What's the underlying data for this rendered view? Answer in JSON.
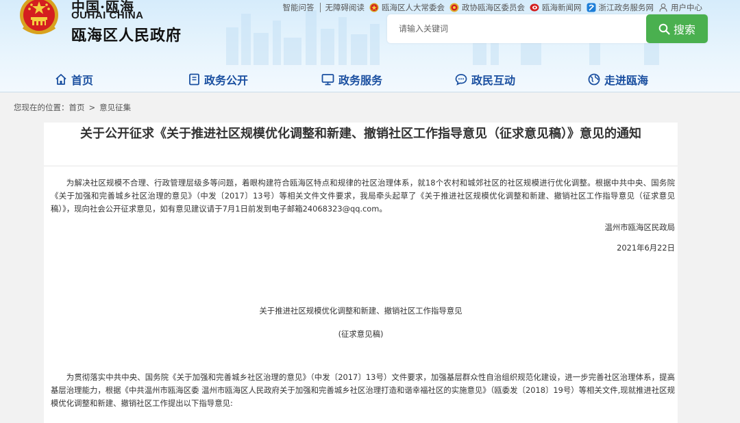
{
  "header": {
    "logo_top": "中国·瓯海",
    "logo_en": "OUHAI CHINA",
    "logo_cn": "瓯海区人民政府",
    "top_links": [
      {
        "label": "智能问答",
        "icon": "none"
      },
      {
        "label": "无障碍阅读",
        "icon": "none"
      },
      {
        "label": "瓯海区人大常委会",
        "icon": "npc-emblem-icon"
      },
      {
        "label": "政协瓯海区委员会",
        "icon": "cppcc-emblem-icon"
      },
      {
        "label": "瓯海新闻网",
        "icon": "news-icon"
      },
      {
        "label": "浙江政务服务网",
        "icon": "service-icon"
      },
      {
        "label": "用户中心",
        "icon": "user-icon"
      }
    ],
    "search": {
      "placeholder": "请输入关键词",
      "button_label": "搜索"
    },
    "nav": [
      {
        "label": "首页",
        "icon": "home-icon"
      },
      {
        "label": "政务公开",
        "icon": "document-icon"
      },
      {
        "label": "政务服务",
        "icon": "monitor-icon"
      },
      {
        "label": "政民互动",
        "icon": "chat-icon"
      },
      {
        "label": "走进瓯海",
        "icon": "globe-icon"
      }
    ],
    "colors": {
      "nav_text": "#1a4fa0",
      "search_button": "#4ab04f"
    }
  },
  "breadcrumb": {
    "prefix": "您现在的位置：",
    "items": [
      "首页",
      "意见征集"
    ],
    "separator": ">"
  },
  "article": {
    "title": "关于公开征求《关于推进社区规模优化调整和新建、撤销社区工作指导意见（征求意见稿）》意见的通知",
    "intro": "为解决社区规模不合理、行政管理层级多等问题，着眼构建符合瓯海区特点和规律的社区治理体系，就18个农村和城郊社区的社区规模进行优化调整。根据中共中央、国务院《关于加强和完善城乡社区治理的意见》（中发〔2017〕13号）等相关文件文件要求，我局牵头起草了《关于推进社区规模优化调整和新建、撤销社区工作指导意见（征求意见稿）》，现向社会公开征求意见，如有意见建议请于7月1日前发到电子邮箱24068323@qq.com。",
    "signature": "温州市瓯海区民政局",
    "date": "2021年6月22日",
    "doc_title": "关于推进社区规模优化调整和新建、撤销社区工作指导意见",
    "doc_subtitle": "(征求意见稿)",
    "body": "为贯彻落实中共中央、国务院《关于加强和完善城乡社区治理的意见》（中发〔2017〕13号）文件要求，加强基层群众性自治组织规范化建设，进一步完善社区治理体系，提高基层治理能力，根据《中共温州市瓯海区委 温州市瓯海区人民政府关于加强和完善城乡社区治理打造和谐幸福社区的实施意见》（瓯委发〔2018〕19号）等相关文件,现就推进社区规模优化调整和新建、撤销社区工作提出以下指导意见:"
  }
}
